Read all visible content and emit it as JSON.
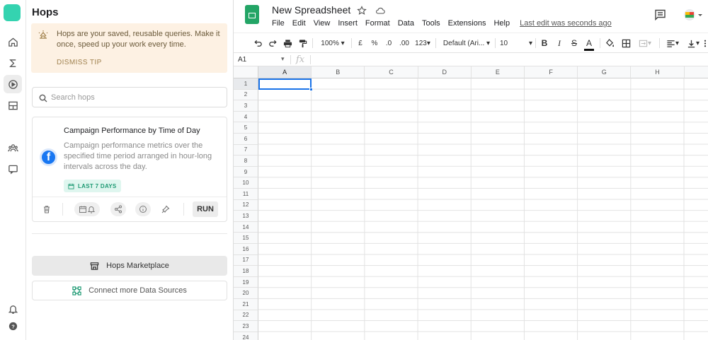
{
  "panel": {
    "title": "Hops",
    "tip": {
      "text": "Hops are your saved, reusable queries. Make it once, speed up your work every time.",
      "dismiss": "DISMISS TIP"
    },
    "search": {
      "placeholder": "Search hops"
    },
    "card": {
      "title": "Campaign Performance by Time of Day",
      "description": "Campaign performance metrics over the specified time period arranged in hour-long intervals across the day.",
      "badge": "LAST 7 DAYS",
      "run_label": "RUN",
      "source_icon": "facebook-icon"
    },
    "marketplace_label": "Hops Marketplace",
    "connect_label": "Connect more Data Sources"
  },
  "sheets": {
    "title": "New Spreadsheet",
    "menu": [
      "File",
      "Edit",
      "View",
      "Insert",
      "Format",
      "Data",
      "Tools",
      "Extensions",
      "Help"
    ],
    "last_edit": "Last edit was seconds ago",
    "toolbar": {
      "zoom": "100%",
      "currency": "£",
      "percent": "%",
      "dec_decrease": ".0",
      "dec_increase": ".00",
      "more_formats": "123",
      "font": "Default (Ari...",
      "font_size": "10",
      "bold": "B",
      "italic": "I",
      "strike": "S",
      "text_color": "A"
    },
    "cell_ref": "A1",
    "fx": "fx",
    "columns": [
      "A",
      "B",
      "C",
      "D",
      "E",
      "F",
      "G",
      "H"
    ],
    "rows": [
      "1",
      "2",
      "3",
      "4",
      "5",
      "6",
      "7",
      "8",
      "9",
      "10",
      "11",
      "12",
      "13",
      "14",
      "15",
      "16",
      "17",
      "18",
      "19",
      "20",
      "21",
      "22",
      "23",
      "24"
    ]
  },
  "colors": {
    "accent": "#34d3b0",
    "sheets_green": "#23a566",
    "selection": "#1a73e8",
    "tip_bg": "#fdf1e3"
  }
}
